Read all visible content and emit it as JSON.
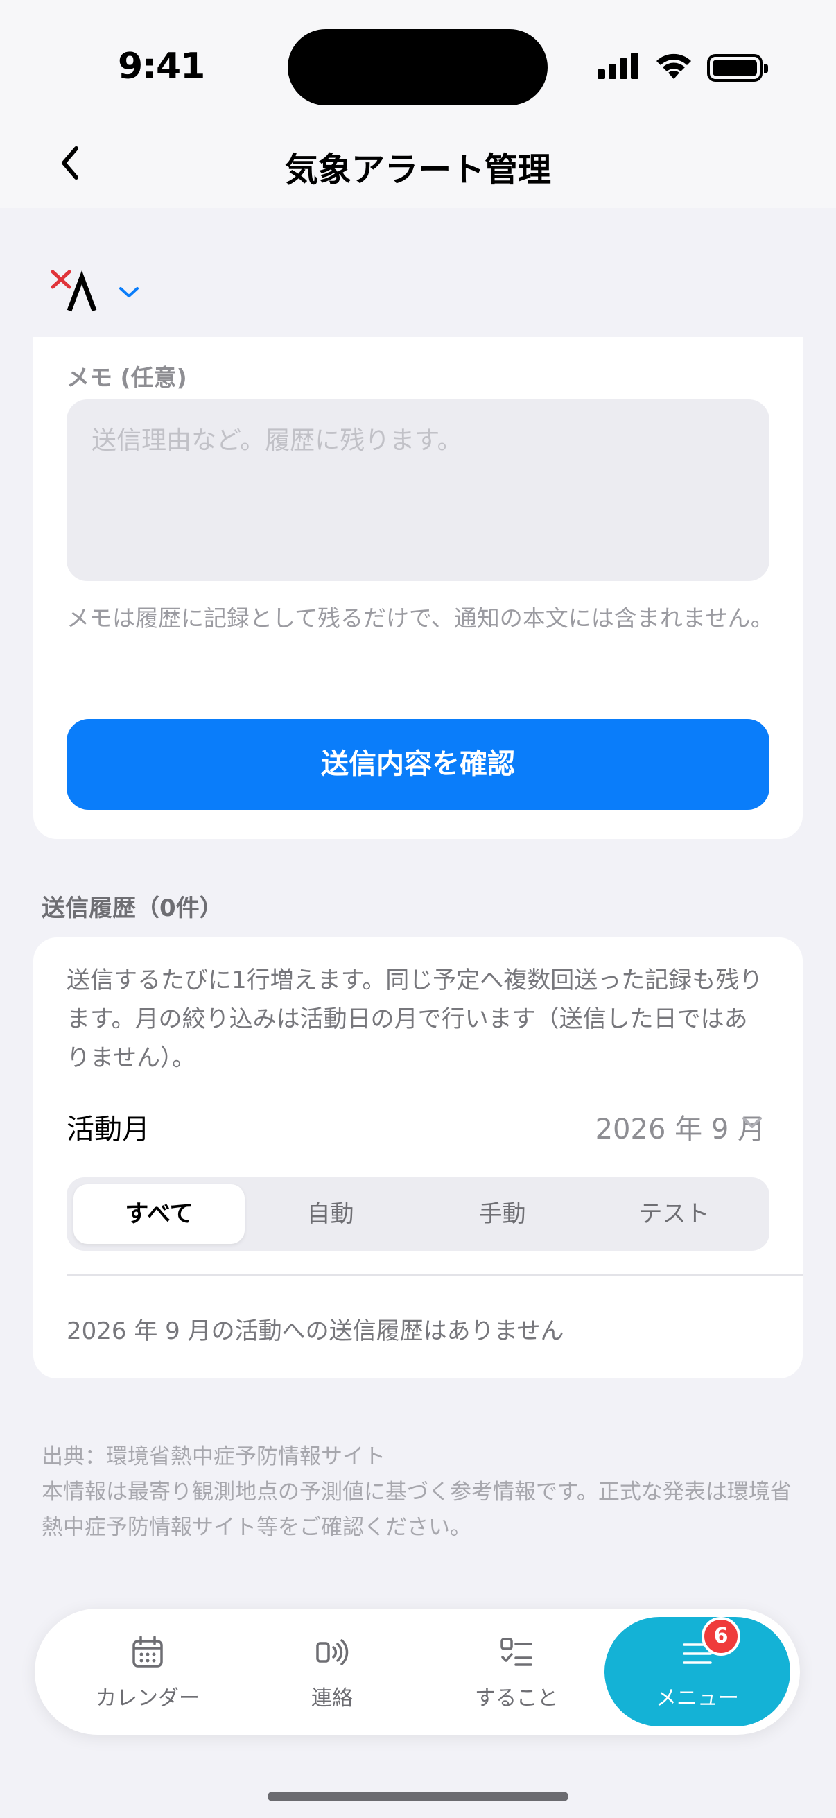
{
  "status_bar": {
    "time": "9:41"
  },
  "header": {
    "title": "気象アラート管理",
    "back_icon": "chevron-left-icon"
  },
  "memo": {
    "label": "メモ (任意)",
    "placeholder": "送信理由など。履歴に残ります。",
    "value": "",
    "hint": "メモは履歴に記録として残るだけで、通知の本文には含まれません。"
  },
  "confirm_button": "送信内容を確認",
  "history": {
    "title": "送信履歴（0件）",
    "description": "送信するたびに1行増えます。同じ予定へ複数回送った記録も残ります。月の絞り込みは活動日の月で行います（送信した日ではありません）。",
    "month_label": "活動月",
    "month_value": "2026 年 9 月",
    "filters": [
      "すべて",
      "自動",
      "手動",
      "テスト"
    ],
    "selected_filter": "すべて",
    "empty_message": "2026 年 9 月の活動への送信履歴はありません"
  },
  "footer": {
    "source": "出典：環境省熱中症予防情報サイト",
    "disclaimer": "本情報は最寄り観測地点の予測値に基づく参考情報です。正式な発表は環境省熱中症予防情報サイト等をご確認ください。"
  },
  "tabbar": {
    "items": [
      {
        "label": "カレンダー",
        "icon": "calendar-icon"
      },
      {
        "label": "連絡",
        "icon": "broadcast-icon"
      },
      {
        "label": "すること",
        "icon": "checklist-icon"
      },
      {
        "label": "メニュー",
        "icon": "menu-icon",
        "badge": "6"
      }
    ],
    "active": "メニュー"
  },
  "colors": {
    "primary": "#0a7dfa",
    "tab_active": "#14b2d6",
    "badge": "#ef3b3b",
    "brand_x": "#e0343a"
  }
}
